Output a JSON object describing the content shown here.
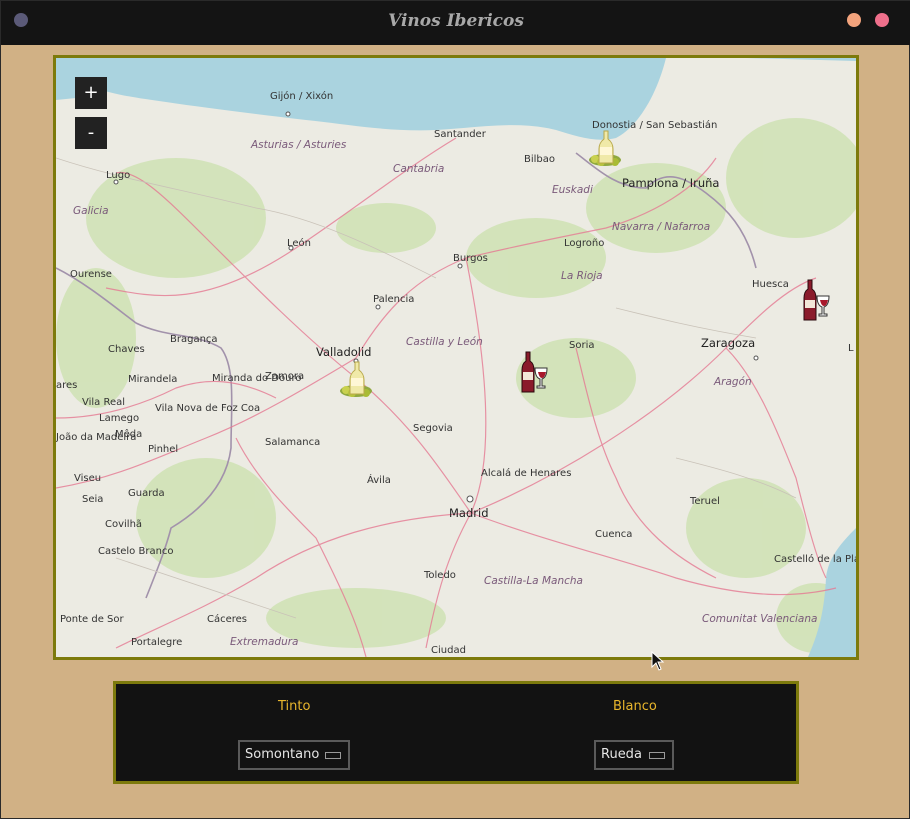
{
  "window": {
    "title": "Vinos Ibericos"
  },
  "map": {
    "zoom_in": "+",
    "zoom_out": "-",
    "cities": {
      "gijon": "Gijón / Xixón",
      "santander": "Santander",
      "donostia": "Donostia / San Sebastián",
      "bilbao": "Bilbao",
      "pamplona": "Pamplona / Iruña",
      "lugo": "Lugo",
      "leon": "León",
      "burgos": "Burgos",
      "logrono": "Logroño",
      "ourense": "Ourense",
      "palencia": "Palencia",
      "huesca": "Huesca",
      "chaves": "Chaves",
      "braganca": "Bragança",
      "valladolid": "Valladolid",
      "soria": "Soria",
      "zaragoza": "Zaragoza",
      "mirandela": "Mirandela",
      "miranda": "Miranda do Douro",
      "zamora": "Zamora",
      "vila_real": "Vila Real",
      "vila_nova": "Vila Nova de Foz Coa",
      "lamego": "Lamego",
      "meda": "Mêda",
      "segovia": "Segovia",
      "joao": "João da Madeira",
      "pinhel": "Pinhel",
      "salamanca": "Salamanca",
      "alcala": "Alcalá de Henares",
      "viseu": "Viseu",
      "avila": "Ávila",
      "seia": "Seia",
      "guarda": "Guarda",
      "madrid": "Madrid",
      "teruel": "Teruel",
      "covilha": "Covilhã",
      "cuenca": "Cuenca",
      "castelo_branco": "Castelo Branco",
      "castello": "Castelló de la Plana",
      "toledo": "Toledo",
      "caceres": "Cáceres",
      "ponte_sor": "Ponte de Sor",
      "portalegre": "Portalegre",
      "ciudad": "Ciudad",
      "ares": "ares",
      "l_edge": "L"
    },
    "regions": {
      "asturias": "Asturias / Asturies",
      "cantabria": "Cantabria",
      "euskadi": "Euskadi",
      "galicia": "Galicia",
      "navarra": "Navarra / Nafarroa",
      "la_rioja": "La Rioja",
      "castilla_leon": "Castilla y León",
      "aragon": "Aragón",
      "castilla_mancha": "Castilla-La Mancha",
      "extremadura": "Extremadura",
      "comunitat": "Comunitat Valenciana"
    },
    "markers": [
      {
        "name": "white-wine-marker-donostia",
        "type": "white"
      },
      {
        "name": "red-wine-marker-huesca",
        "type": "red"
      },
      {
        "name": "red-wine-marker-soria",
        "type": "red"
      },
      {
        "name": "white-wine-marker-valladolid",
        "type": "white"
      }
    ],
    "colors": {
      "water": "#aad3df",
      "land": "#ecebe3",
      "road": "#e57a93"
    }
  },
  "panel": {
    "tinto_label": "Tinto",
    "blanco_label": "Blanco",
    "tinto_value": "Somontano",
    "blanco_value": "Rueda",
    "accent": "#e9b62c",
    "border": "#7d7a0c"
  }
}
